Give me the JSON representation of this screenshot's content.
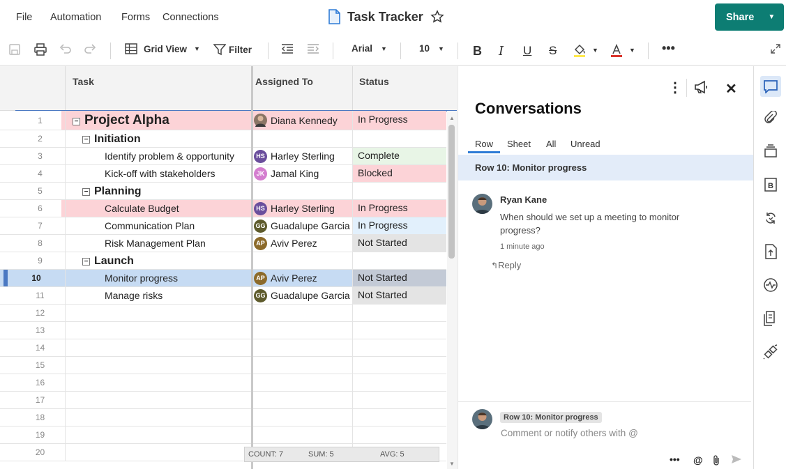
{
  "menu": [
    "File",
    "Automation",
    "Forms",
    "Connections"
  ],
  "title": "Task Tracker",
  "share_label": "Share",
  "toolbar": {
    "view": "Grid View",
    "filter": "Filter",
    "font": "Arial",
    "size": "10"
  },
  "columns": {
    "task": "Task",
    "assigned": "Assigned To",
    "status": "Status"
  },
  "rows": [
    {
      "n": "1",
      "task": "Project Alpha",
      "level": 0,
      "assigned": "Diana Kennedy",
      "initials": "",
      "status": "In Progress"
    },
    {
      "n": "2",
      "task": "Initiation",
      "level": 1,
      "assigned": "",
      "initials": "",
      "status": ""
    },
    {
      "n": "3",
      "task": "Identify problem & opportunity",
      "level": 2,
      "assigned": "Harley Sterling",
      "initials": "HS",
      "status": "Complete"
    },
    {
      "n": "4",
      "task": "Kick-off with stakeholders",
      "level": 2,
      "assigned": "Jamal King",
      "initials": "JK",
      "status": "Blocked"
    },
    {
      "n": "5",
      "task": "Planning",
      "level": 1,
      "assigned": "",
      "initials": "",
      "status": ""
    },
    {
      "n": "6",
      "task": "Calculate Budget",
      "level": 2,
      "assigned": "Harley Sterling",
      "initials": "HS",
      "status": "In Progress"
    },
    {
      "n": "7",
      "task": "Communication Plan",
      "level": 2,
      "assigned": "Guadalupe Garcia",
      "initials": "GG",
      "status": "In Progress"
    },
    {
      "n": "8",
      "task": "Risk Management Plan",
      "level": 2,
      "assigned": "Aviv Perez",
      "initials": "AP",
      "status": "Not Started"
    },
    {
      "n": "9",
      "task": "Launch",
      "level": 1,
      "assigned": "",
      "initials": "",
      "status": ""
    },
    {
      "n": "10",
      "task": "Monitor progress",
      "level": 2,
      "assigned": "Aviv Perez",
      "initials": "AP",
      "status": "Not Started"
    },
    {
      "n": "11",
      "task": "Manage risks",
      "level": 2,
      "assigned": "Guadalupe Garcia",
      "initials": "GG",
      "status": "Not Started"
    },
    {
      "n": "12",
      "task": "",
      "level": 2,
      "assigned": "",
      "initials": "",
      "status": ""
    },
    {
      "n": "13",
      "task": "",
      "level": 2,
      "assigned": "",
      "initials": "",
      "status": ""
    },
    {
      "n": "14",
      "task": "",
      "level": 2,
      "assigned": "",
      "initials": "",
      "status": ""
    },
    {
      "n": "15",
      "task": "",
      "level": 2,
      "assigned": "",
      "initials": "",
      "status": ""
    },
    {
      "n": "16",
      "task": "",
      "level": 2,
      "assigned": "",
      "initials": "",
      "status": ""
    },
    {
      "n": "17",
      "task": "",
      "level": 2,
      "assigned": "",
      "initials": "",
      "status": ""
    },
    {
      "n": "18",
      "task": "",
      "level": 2,
      "assigned": "",
      "initials": "",
      "status": ""
    },
    {
      "n": "19",
      "task": "",
      "level": 2,
      "assigned": "",
      "initials": "",
      "status": ""
    },
    {
      "n": "20",
      "task": "",
      "level": 2,
      "assigned": "",
      "initials": "",
      "status": ""
    }
  ],
  "status_bar": {
    "count": "COUNT:  7",
    "sum": "SUM:  5",
    "avg": "AVG:  5"
  },
  "conversations": {
    "title": "Conversations",
    "tabs": [
      "Row",
      "Sheet",
      "All",
      "Unread"
    ],
    "context": "Row 10: Monitor progress",
    "comment": {
      "author": "Ryan Kane",
      "text": "When should we set up a meeting to monitor progress?",
      "time": "1 minute ago",
      "reply": "Reply"
    },
    "composer_tag": "Row 10: Monitor progress",
    "composer_placeholder": "Comment or notify others with @"
  }
}
